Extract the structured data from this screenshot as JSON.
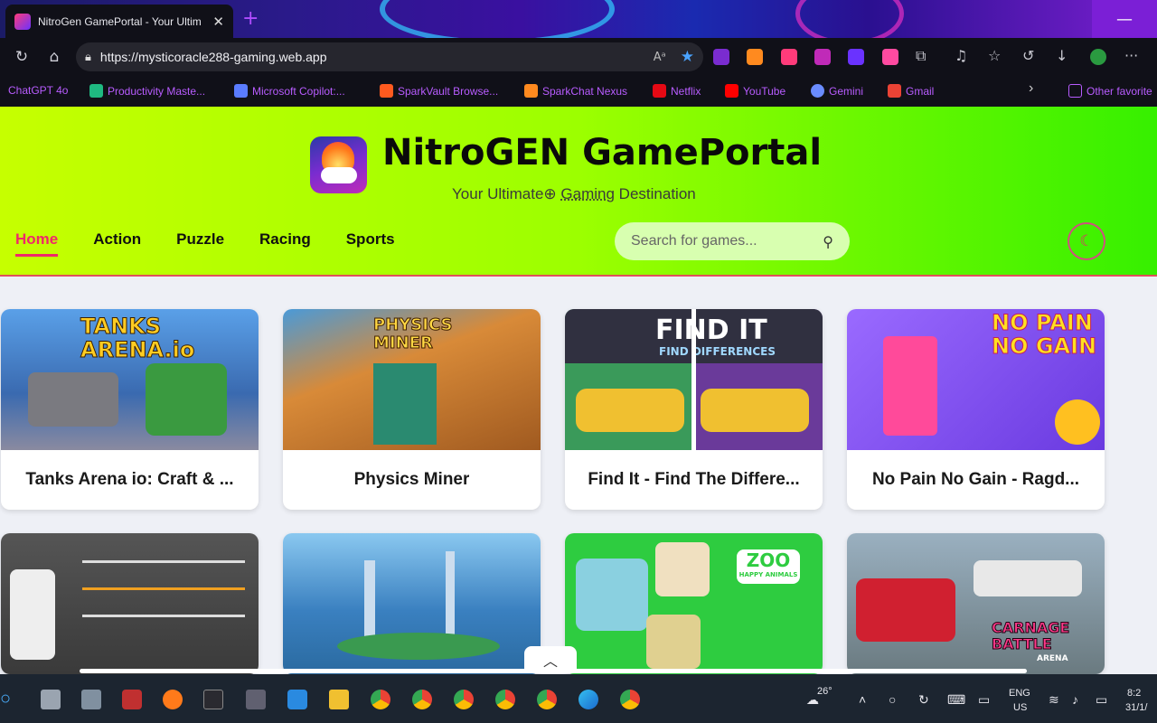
{
  "browser": {
    "tab_title": "NitroGen GamePortal - Your Ultim",
    "tab_close": "✕",
    "new_tab": "+",
    "url": "https://mysticoracle288-gaming.web.app",
    "read_aloud": "Aᵃ",
    "favorites": [
      {
        "label": "ChatGPT 4o",
        "color": "#333333"
      },
      {
        "label": "Productivity Maste...",
        "color": "#1fb981"
      },
      {
        "label": "Microsoft Copilot:...",
        "color": "#5a7cff"
      },
      {
        "label": "SparkVault Browse...",
        "color": "#ff5a1f"
      },
      {
        "label": "SparkChat Nexus",
        "color": "#ff8a1f"
      },
      {
        "label": "Netflix",
        "color": "#e50914"
      },
      {
        "label": "YouTube",
        "color": "#ff0000"
      },
      {
        "label": "Gemini",
        "color": "#6a8cff"
      },
      {
        "label": "Gmail",
        "color": "#ea4335"
      }
    ],
    "more_favorites": "›",
    "other_favorites": "Other favorite"
  },
  "site": {
    "brand": "NitroGEN GamePortal",
    "tagline_a": "Your Ultimate",
    "tagline_b": "Gaming",
    "tagline_c": "Destination",
    "nav": [
      {
        "label": "Home",
        "active": true
      },
      {
        "label": "Action"
      },
      {
        "label": "Puzzle"
      },
      {
        "label": "Racing"
      },
      {
        "label": "Sports"
      }
    ],
    "search_placeholder": "Search for games...",
    "theme_icon": "moon-icon"
  },
  "games": [
    {
      "title": "Tanks Arena io: Craft & ...",
      "art": "TANKS ARENA.io",
      "bg": "#3a78c8"
    },
    {
      "title": "Physics Miner",
      "art": "PHYSICS MINER",
      "bg": "#c86a28"
    },
    {
      "title": "Find It - Find The Differe...",
      "art": "FIND IT",
      "art_sub": "FIND DIFFERENCES",
      "bg": "#4aa048"
    },
    {
      "title": "No Pain No Gain - Ragd...",
      "art": "NO PAIN NO GAIN",
      "bg": "#8a5cff"
    },
    {
      "title": "",
      "art": "",
      "bg": "#4a4a4a"
    },
    {
      "title": "",
      "art": "",
      "bg": "#3a7ab8"
    },
    {
      "title": "",
      "art": "ZOO",
      "art_sub": "HAPPY ANIMALS",
      "bg": "#2ecc40"
    },
    {
      "title": "",
      "art": "CARNAGE BATTLE",
      "art_sub": "ARENA",
      "bg": "#7a8a9a"
    }
  ],
  "taskbar": {
    "weather": "26°",
    "lang_top": "ENG",
    "lang_bottom": "US",
    "time": "8:2",
    "date": "31/1/"
  }
}
